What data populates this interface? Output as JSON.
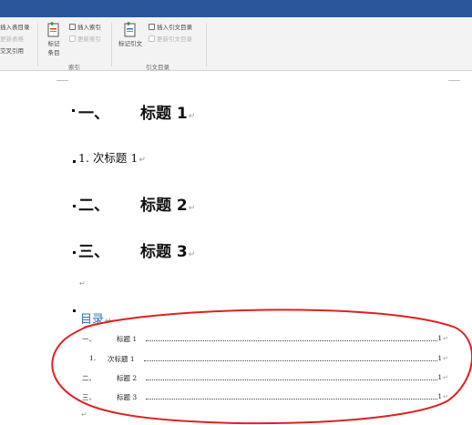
{
  "ribbon": {
    "left_group": {
      "insert_table_of_figures": "插入表目录",
      "update_table": "更新表格",
      "cross_reference": "交叉引用"
    },
    "index_group": {
      "mark_entry": "标记\n条目",
      "mark_entry_line1": "标记",
      "mark_entry_line2": "条目",
      "insert_index": "插入索引",
      "update_index": "更新索引",
      "label": "索引"
    },
    "citations_group": {
      "mark_citation": "标记引文",
      "insert_table_of_authorities": "插入引文目录",
      "update_table": "更新引文目录",
      "label": "引文目录"
    }
  },
  "document": {
    "paragraph_mark": "↵",
    "headings": [
      {
        "number": "一、",
        "text": "标题 1"
      },
      {
        "number": "二、",
        "text": "标题 2"
      },
      {
        "number": "三、",
        "text": "标题 3"
      }
    ],
    "subheading": {
      "number": "1.",
      "text": "次标题 1"
    },
    "toc": {
      "title": "目录",
      "entries": [
        {
          "number": "一、",
          "text": "标题 1",
          "page": "1"
        },
        {
          "number": "1.",
          "text": "次标题 1",
          "page": "1"
        },
        {
          "number": "二、",
          "text": "标题 2",
          "page": "1"
        },
        {
          "number": "三、",
          "text": "标题 3",
          "page": "1"
        }
      ]
    }
  },
  "annotation": {
    "shape": "ellipse",
    "color": "#e02020"
  },
  "colors": {
    "title_bar": "#2b579a",
    "toc_title": "#2e74b5",
    "ribbon_bg": "#f3f3f3"
  }
}
